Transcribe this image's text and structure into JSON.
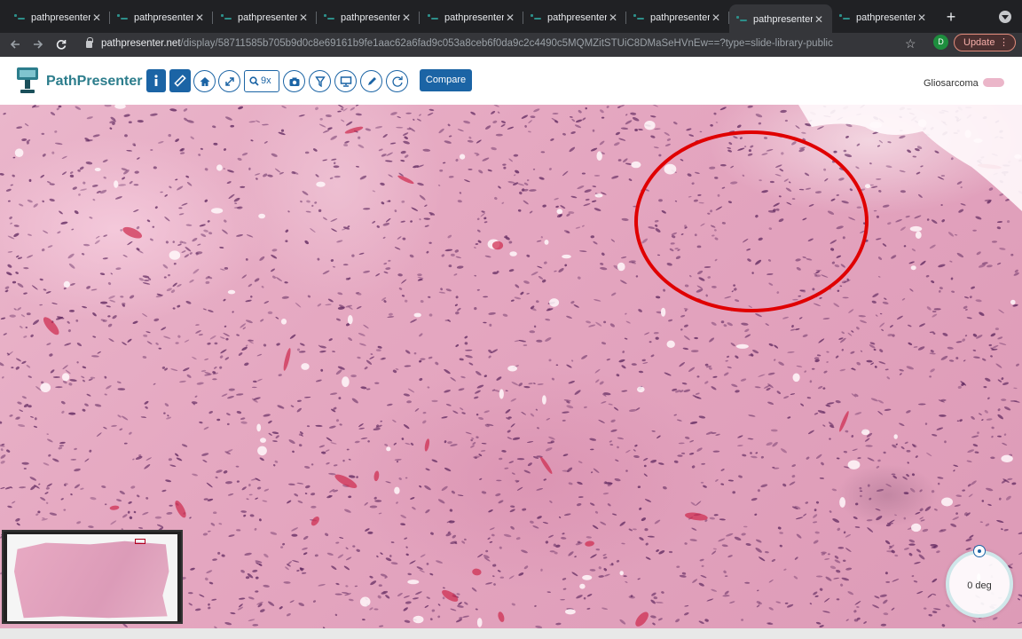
{
  "browser": {
    "tabs": [
      {
        "title": "pathpresenter",
        "active": false
      },
      {
        "title": "pathpresenter",
        "active": false
      },
      {
        "title": "pathpresenter",
        "active": false
      },
      {
        "title": "pathpresenter",
        "active": false
      },
      {
        "title": "pathpresenter",
        "active": false
      },
      {
        "title": "pathpresenter",
        "active": false
      },
      {
        "title": "pathpresenter",
        "active": false
      },
      {
        "title": "pathpresenter",
        "active": true
      },
      {
        "title": "pathpresenter",
        "active": false
      }
    ],
    "url_host": "pathpresenter.net",
    "url_path": "/display/58711585b705b9d0c8e69161b9fe1aac62a6fad9c053a8ceb6f0da9c2c4490c5MQMZitSTUiC8DMaSeHVnEw==?type=slide-library-public",
    "profile_initial": "D",
    "update_label": "Update"
  },
  "app": {
    "brand": "PathPresenter",
    "zoom_level": "9x",
    "compare_label": "Compare",
    "slide_title": "Gliosarcoma"
  },
  "viewer": {
    "rotation_label": "0 deg"
  },
  "colors": {
    "accent": "#1b64a5",
    "brand": "#2c7d8c",
    "annotation": "#e00000",
    "tissue": "#e2a2bd"
  },
  "icons": {
    "toolbar": [
      "info-icon",
      "ruler-icon",
      "home-icon",
      "expand-icon",
      "zoom-icon",
      "camera-icon",
      "filter-icon",
      "monitor-icon",
      "pencil-icon",
      "rotate-icon"
    ]
  }
}
